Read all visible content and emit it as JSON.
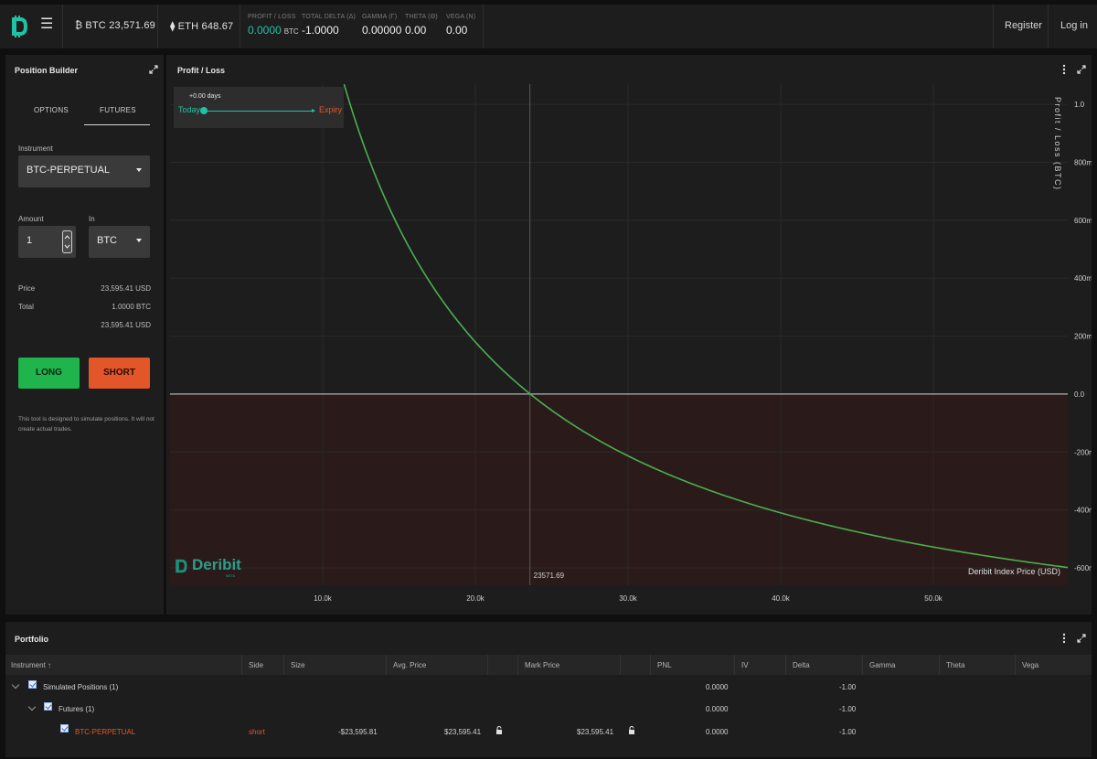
{
  "topbar": {
    "btc": {
      "icon": "bitcoin-icon",
      "label": "BTC",
      "price": "23,571.69"
    },
    "eth": {
      "icon": "ethereum-icon",
      "label": "ETH",
      "price": "648.67"
    },
    "stats": [
      {
        "label": "PROFIT / LOSS",
        "value": "0.0000",
        "unit": "BTC"
      },
      {
        "label": "TOTAL DELTA (Δ)",
        "value": "-1.0000",
        "unit": ""
      },
      {
        "label": "GAMMA (Γ)",
        "value": "0.00000",
        "unit": ""
      },
      {
        "label": "THETA (Θ)",
        "value": "0.00",
        "unit": ""
      },
      {
        "label": "VEGA (N)",
        "value": "0.00",
        "unit": ""
      }
    ],
    "register_label": "Register",
    "login_label": "Log in"
  },
  "builder": {
    "title": "Position Builder",
    "tabs": [
      "OPTIONS",
      "FUTURES"
    ],
    "active_tab": "FUTURES",
    "instrument_label": "Instrument",
    "instrument_value": "BTC-PERPETUAL",
    "amount_label": "Amount",
    "amount_value": "1",
    "in_label": "In",
    "in_value": "BTC",
    "price_label": "Price",
    "price_value": "23,595.41 USD",
    "total_label": "Total",
    "total_btc": "1.0000 BTC",
    "total_usd": "23,595.41 USD",
    "long_label": "LONG",
    "short_label": "SHORT",
    "disclaimer_line1": "This tool is designed to simulate positions. It will not",
    "disclaimer_line2": "create actual trades.",
    "colors": {
      "long": "#1fb44c",
      "short": "#e2562a"
    }
  },
  "chart_panel": {
    "title": "Profit / Loss",
    "days_label": "+0.00 days",
    "today_label": "Today",
    "expiry_label": "Expiry",
    "brand": "Deribit",
    "brand_sub": "BETA"
  },
  "chart_data": {
    "type": "line",
    "ylabel": "Profit / Loss  (BTC)",
    "xlabel": "Deribit Index Price  (USD)",
    "x_ticks": [
      "10.0k",
      "20.0k",
      "30.0k",
      "40.0k",
      "50.0k"
    ],
    "x_tick_values": [
      10000,
      20000,
      30000,
      40000,
      50000
    ],
    "y_ticks": [
      "1.0",
      "800m",
      "600m",
      "400m",
      "200m",
      "0.0",
      "-200m",
      "-400m",
      "-600m"
    ],
    "y_tick_values": [
      1.0,
      0.8,
      0.6,
      0.4,
      0.2,
      0.0,
      -0.2,
      -0.4,
      -0.6
    ],
    "xlim": [
      0,
      58800
    ],
    "ylim": [
      -0.66,
      1.07
    ],
    "crosshair_x": 23571.69,
    "crosshair_label": "23571.69",
    "series": [
      {
        "entry": 23595.41,
        "amount": 1,
        "x_from": 11400,
        "x_to": 58800
      }
    ],
    "colors": {
      "line": "#4caf50",
      "loss_area": "#2a1a19",
      "grid": "#2a2a2a",
      "axis": "#bdbdbd"
    }
  },
  "portfolio": {
    "title": "Portfolio",
    "columns": [
      "Instrument",
      "Side",
      "Size",
      "Avg. Price",
      "Mark Price",
      "PNL",
      "IV",
      "Delta",
      "Gamma",
      "Theta",
      "Vega"
    ],
    "sort_indicator": "↑",
    "rows": [
      {
        "name": "Simulated Positions (1)",
        "side": "",
        "size": "",
        "avg": "",
        "mark": "",
        "pnl": "0.0000",
        "delta": "-1.00"
      },
      {
        "name": "Futures (1)",
        "side": "",
        "size": "",
        "avg": "",
        "mark": "",
        "pnl": "0.0000",
        "delta": "-1.00"
      },
      {
        "name": "BTC-PERPETUAL",
        "side": "short",
        "size": "-$23,595.81",
        "avg": "$23,595.41",
        "mark": "$23,595.41",
        "pnl": "0.0000",
        "delta": "-1.00"
      }
    ]
  }
}
